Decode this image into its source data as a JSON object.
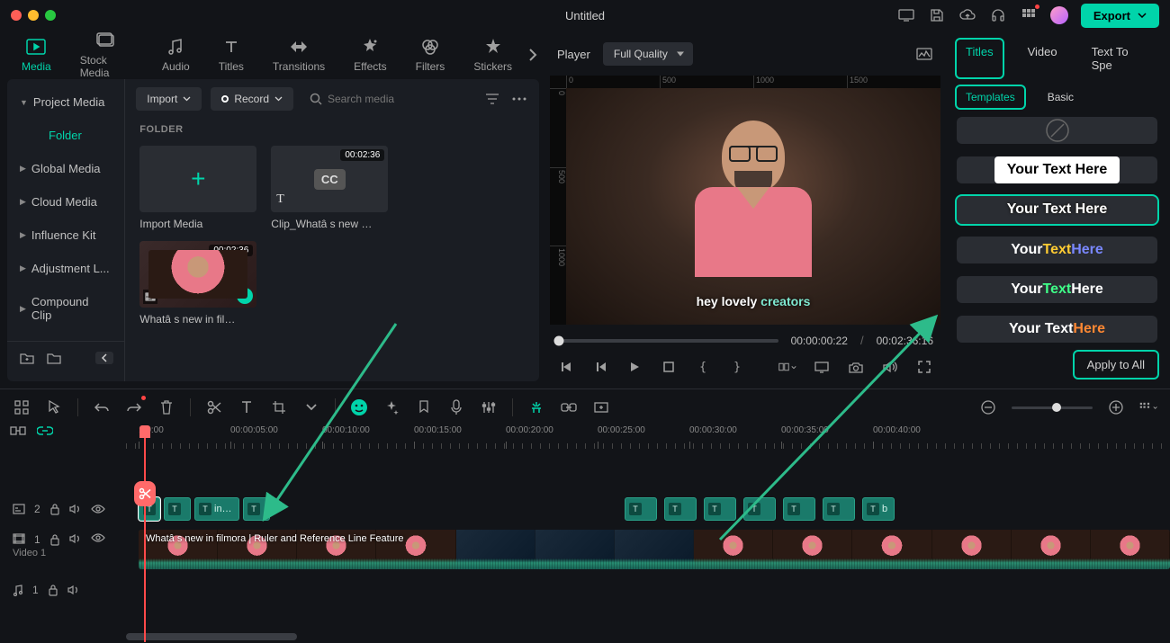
{
  "titlebar": {
    "title": "Untitled",
    "export": "Export"
  },
  "top_tabs": [
    "Media",
    "Stock Media",
    "Audio",
    "Titles",
    "Transitions",
    "Effects",
    "Filters",
    "Stickers"
  ],
  "sidebar": {
    "items": [
      "Project Media",
      "Folder",
      "Global Media",
      "Cloud Media",
      "Influence Kit",
      "Adjustment L...",
      "Compound Clip"
    ]
  },
  "media_toolbar": {
    "import": "Import",
    "record": "Record",
    "search_placeholder": "Search media"
  },
  "folder_label": "FOLDER",
  "media_cards": {
    "import_caption": "Import Media",
    "cc_duration": "00:02:36",
    "cc_caption": "Clip_Whatâ  s new …",
    "vid_duration": "00:02:36",
    "vid_caption": "Whatâ  s new in fil…"
  },
  "preview": {
    "label": "Player",
    "quality": "Full Quality",
    "caption_plain": "hey lovely ",
    "caption_accent": "creators",
    "current": "00:00:00:22",
    "sep": "/",
    "duration": "00:02:36:16",
    "rulers_h": [
      "0",
      "500",
      "1000",
      "1500"
    ],
    "rulers_v": [
      "0",
      "500",
      "1000"
    ]
  },
  "right": {
    "tabs": [
      "Titles",
      "Video",
      "Text To Spe"
    ],
    "subtabs": [
      "Templates",
      "Basic"
    ],
    "templates": [
      {
        "kind": "none",
        "text": ""
      },
      {
        "kind": "pill",
        "text": "Your Text Here"
      },
      {
        "kind": "outline",
        "text": "Your Text Here"
      },
      {
        "kind": "tri1",
        "t1": "Your ",
        "t2": "Text ",
        "t3": "Here"
      },
      {
        "kind": "tri2",
        "t1": "Your ",
        "t2": "Text ",
        "t3": "Here"
      },
      {
        "kind": "tri3",
        "t1": "Your Text ",
        "t2": "Here"
      }
    ],
    "apply": "Apply to All"
  },
  "timeline": {
    "ticks": [
      ":00:00",
      "00:00:05:00",
      "00:00:10:00",
      "00:00:15:00",
      "00:00:20:00",
      "00:00:25:00",
      "00:00:30:00",
      "00:00:35:00",
      "00:00:40:00"
    ],
    "track2_badge": "2",
    "track1_badge": "1",
    "track1_label": "Video 1",
    "audio_badge": "1",
    "clip_in_label": "in…",
    "clip_b_label": "b",
    "video_clip_label": "Whatâ  s new in filmora | Ruler and Reference Line Feature"
  }
}
